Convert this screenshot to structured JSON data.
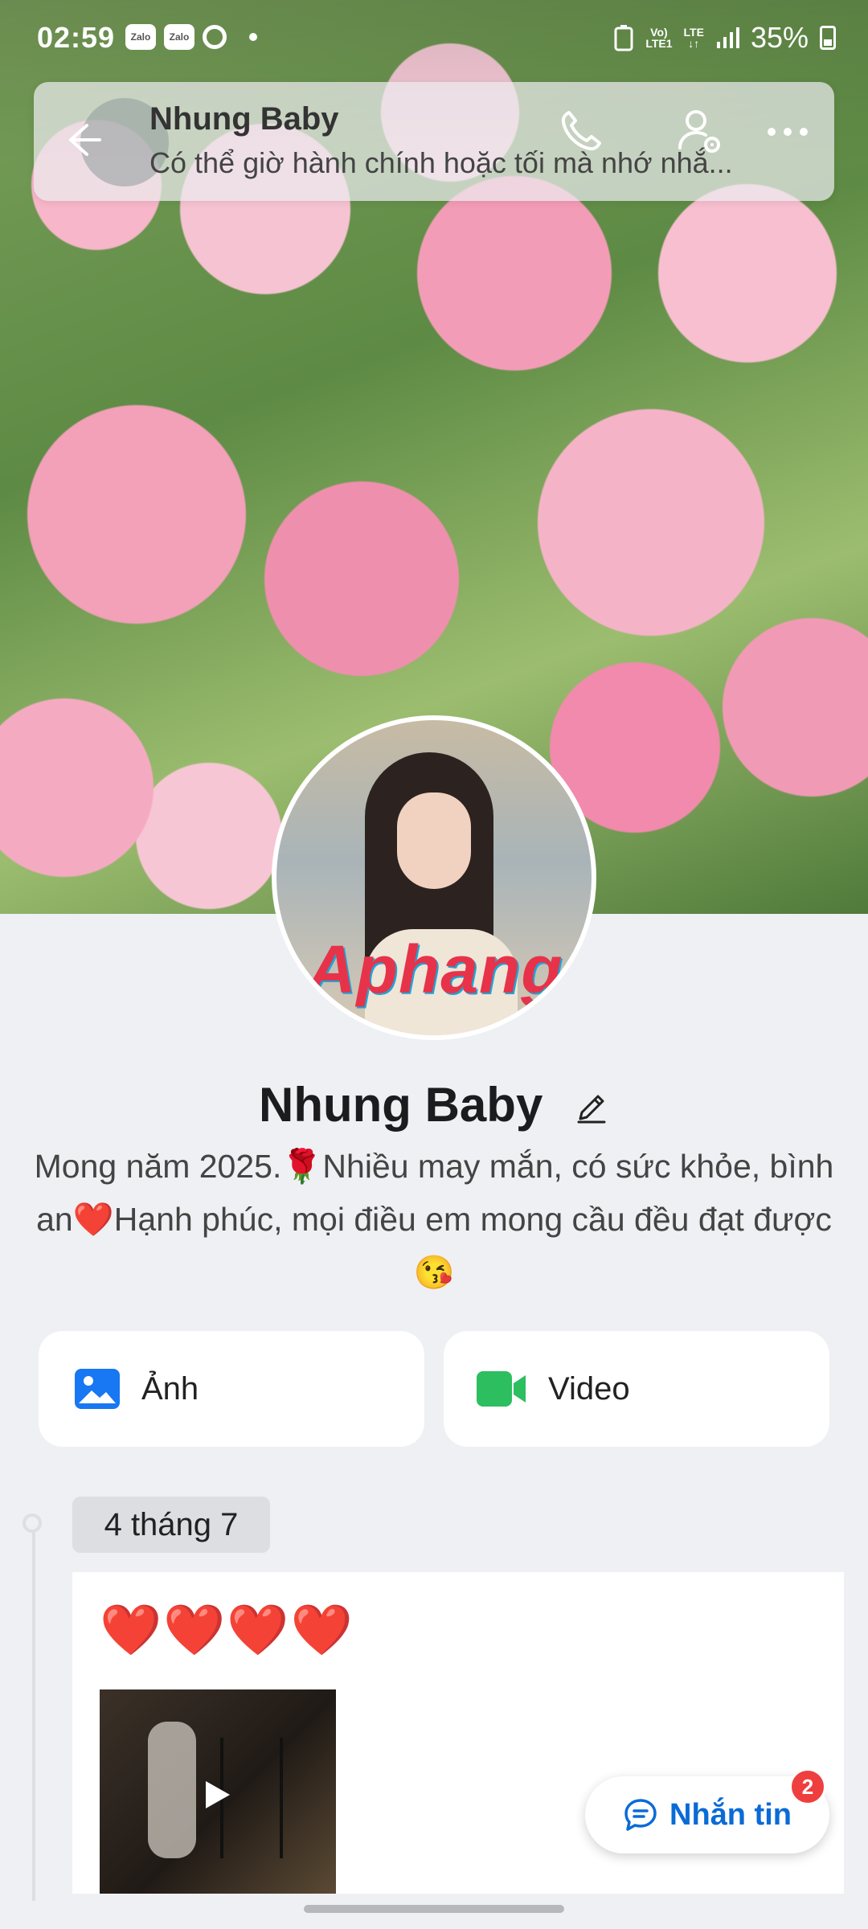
{
  "status_bar": {
    "time": "02:59",
    "zalo_badge_1": "Zalo",
    "zalo_badge_2": "Zalo",
    "network_top": "Vo)",
    "network_bottom": "LTE1",
    "lte": "LTE",
    "battery": "35%"
  },
  "header": {
    "name": "Nhung Baby",
    "subtitle": "Có thể giờ hành chính hoặc tối mà nhớ nhắ..."
  },
  "profile": {
    "name": "Nhung Baby",
    "bio": "Mong năm 2025.🌹Nhiều may mắn, có sức khỏe, bình an❤️Hạnh phúc, mọi điều em mong cầu đều đạt được 😘",
    "watermark": "Aphang"
  },
  "media_buttons": {
    "photo_label": "Ảnh",
    "video_label": "Video"
  },
  "timeline": {
    "date": "4 tháng 7",
    "post_text": "❤️❤️❤️❤️"
  },
  "message_button": {
    "label": "Nhắn tin",
    "badge": "2"
  },
  "colors": {
    "accent": "#0a6bd6",
    "photo_icon": "#1877f2",
    "video_icon": "#2dbe60",
    "badge": "#ef3e3e"
  }
}
